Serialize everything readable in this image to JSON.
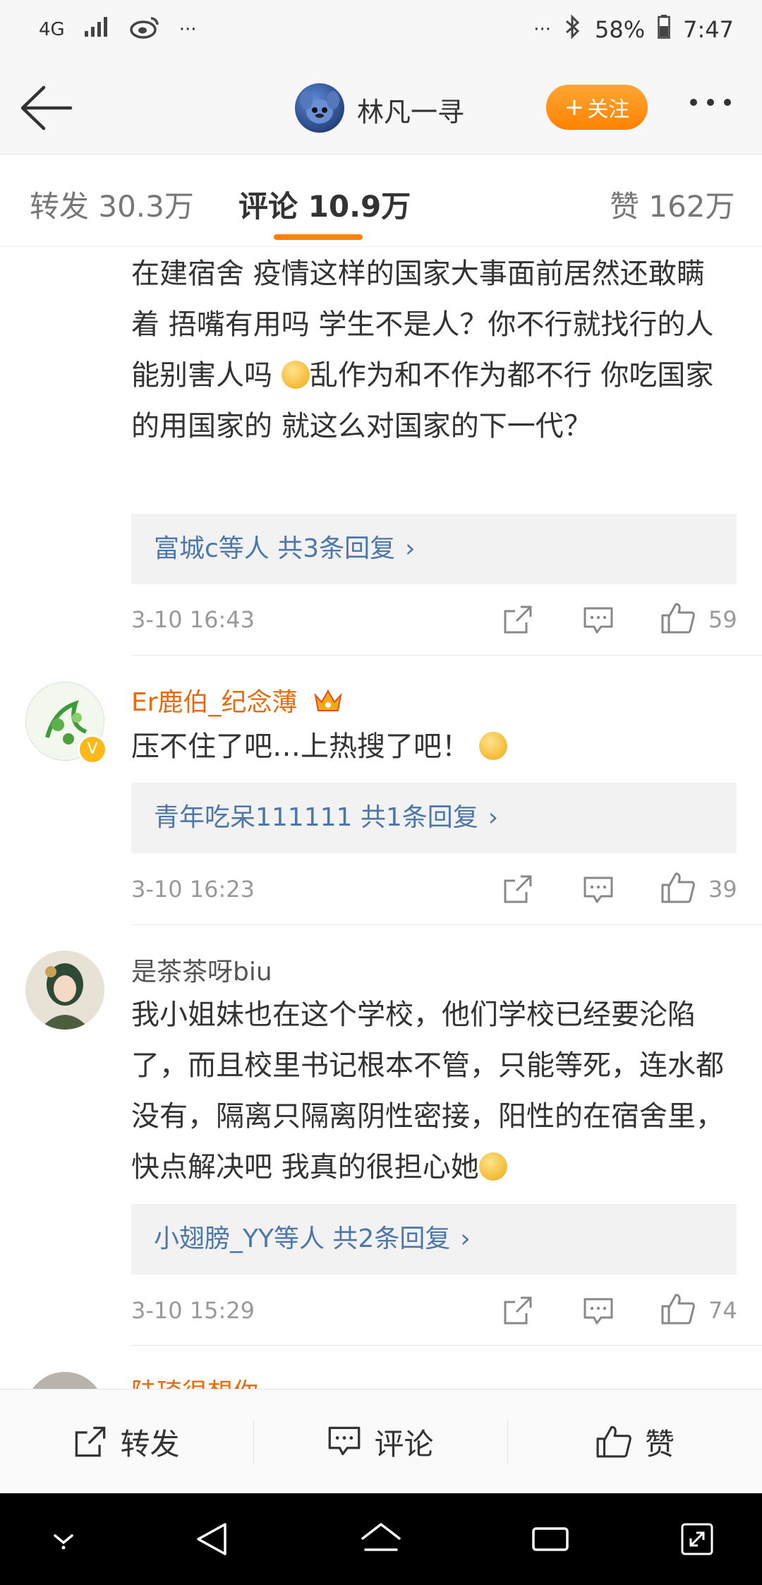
{
  "status_bar": {
    "network": "4G",
    "left_more": "···",
    "right_more": "···",
    "battery": "58%",
    "time": "7:47"
  },
  "header": {
    "title": "林凡一寻",
    "follow_label": "关注",
    "follow_prefix": "+"
  },
  "tabs": [
    {
      "label": "转发 30.3万"
    },
    {
      "label": "评论 10.9万"
    },
    {
      "label": "赞 162万"
    }
  ],
  "comments": [
    {
      "text": "在建宿舍 疫情这样的国家大事面前居然还敢瞒着 捂嘴有用吗 学生不是人？你不行就找行的人 能别害人吗",
      "text_after_emoji": "乱作为和不作为都不行 你吃国家的用国家的 就这么对国家的下一代？",
      "replies": "富城c等人 共3条回复",
      "time": "3-10 16:43",
      "likes": "59"
    },
    {
      "username": "Er鹿伯_纪念薄",
      "text": "压不住了吧…上热搜了吧！",
      "replies": "青年吃呆111111 共1条回复",
      "time": "3-10 16:23",
      "likes": "39"
    },
    {
      "username": "是茶茶呀biu",
      "text": "我小姐妹也在这个学校，他们学校已经要沦陷了，而且校里书记根本不管，只能等死，连水都没有，隔离只隔离阴性密接，阳性的在宿舍里，快点解决吧 我真的很担心她",
      "replies": "小翅膀_YY等人 共2条回复",
      "time": "3-10 15:29",
      "likes": "74"
    },
    {
      "username": "陆琦很想你"
    }
  ],
  "bottom_bar": {
    "repost": "转发",
    "comment": "评论",
    "like": "赞"
  },
  "colors": {
    "accent": "#ff8200",
    "link": "#4e77a9",
    "vip_name": "#e86b0f",
    "muted": "#999999"
  }
}
